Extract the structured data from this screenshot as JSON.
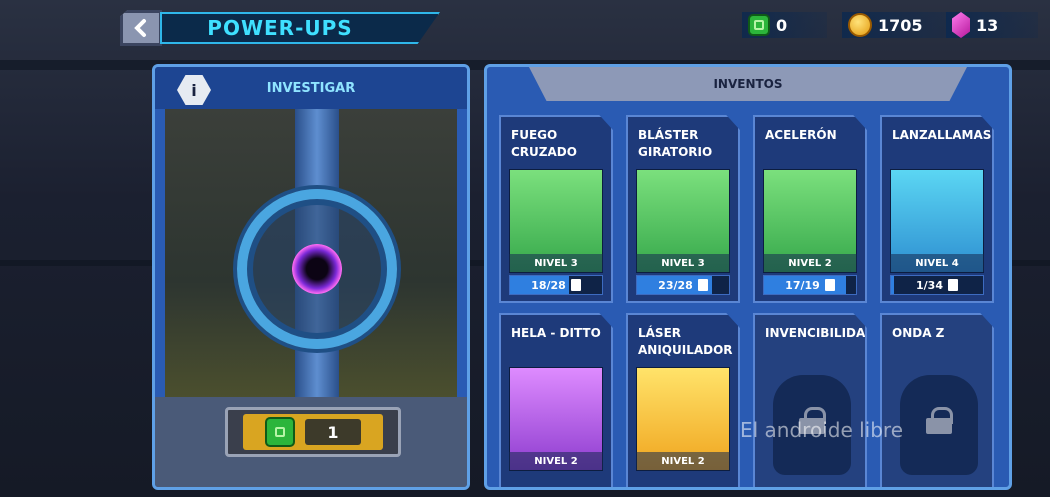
{
  "header": {
    "title": "POWER-UPS"
  },
  "currencies": [
    {
      "icon": "green-chip-icon",
      "value": "0"
    },
    {
      "icon": "coin-icon",
      "value": "1705"
    },
    {
      "icon": "gem-icon",
      "value": "13"
    }
  ],
  "research": {
    "title": "INVESTIGAR",
    "info_label": "i",
    "chip_count": "1"
  },
  "inventory": {
    "title": "INVENTOS",
    "items": [
      {
        "name": "FUEGO\nCRUZADO",
        "level": "NIVEL 3",
        "progress": "18/28",
        "progress_fraction": 0.64,
        "art": "green"
      },
      {
        "name": "BLÁSTER\nGIRATORIO",
        "level": "NIVEL 3",
        "progress": "23/28",
        "progress_fraction": 0.82,
        "art": "green"
      },
      {
        "name": "ACELERÓN",
        "level": "NIVEL 2",
        "progress": "17/19",
        "progress_fraction": 0.89,
        "art": "green"
      },
      {
        "name": "LANZALLAMAS",
        "level": "NIVEL 4",
        "progress": "1/34",
        "progress_fraction": 0.03,
        "art": "cyan"
      },
      {
        "name": "HELA - DITTO",
        "level": "NIVEL 2",
        "art": "purple"
      },
      {
        "name": "LÁSER\nANIQUILADOR",
        "level": "NIVEL 2",
        "art": "yellow"
      },
      {
        "name": "INVENCIBILIDAD",
        "locked": true
      },
      {
        "name": "ONDA Z",
        "locked": true
      }
    ]
  },
  "watermark": "El androide libre"
}
